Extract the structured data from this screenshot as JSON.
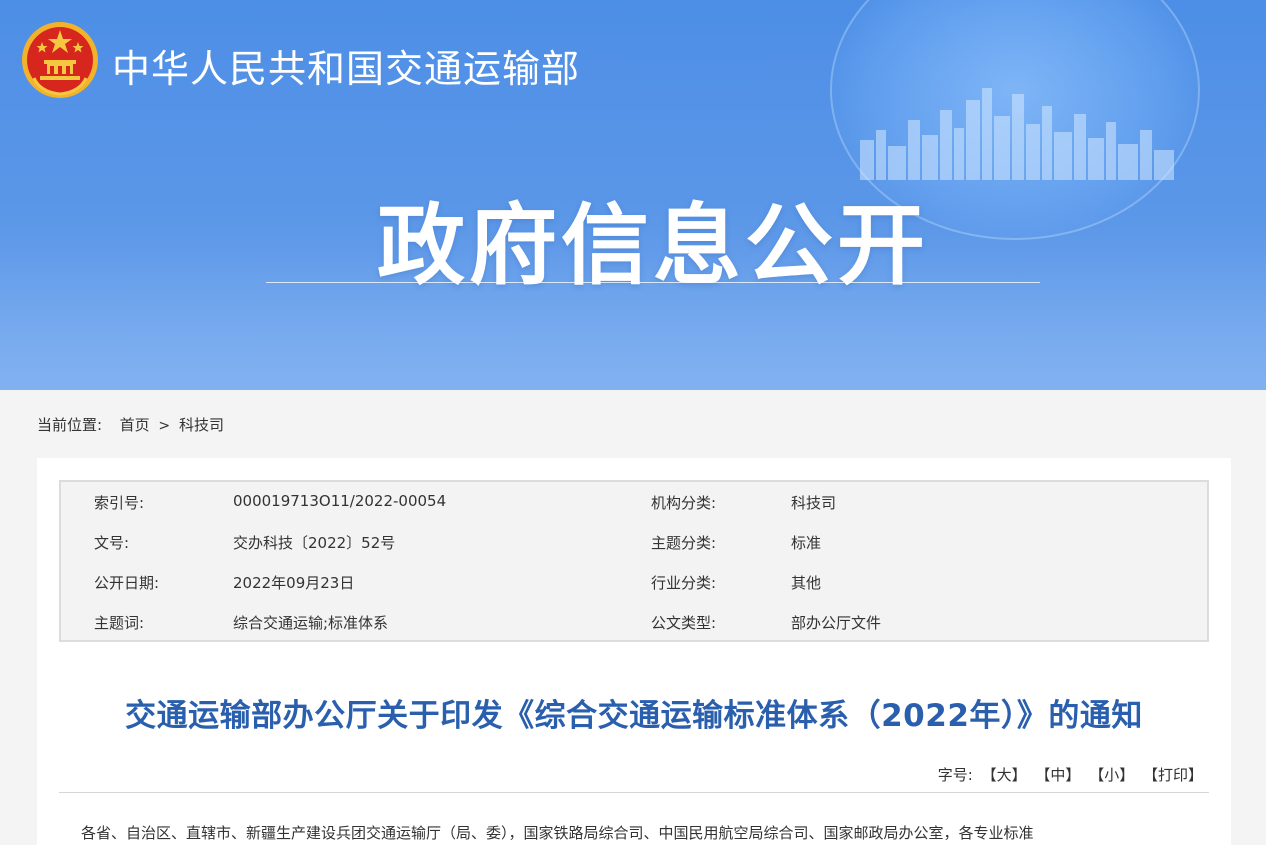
{
  "header": {
    "ministry_name": "中华人民共和国交通运输部",
    "banner_title": "政府信息公开",
    "emblem_icon": "national-emblem-icon"
  },
  "breadcrumb": {
    "label": "当前位置:",
    "items": [
      "首页",
      "科技司"
    ],
    "separator": ">"
  },
  "meta": {
    "rows": [
      {
        "k1": "索引号:",
        "v1": "000019713O11/2022-00054",
        "k2": "机构分类:",
        "v2": "科技司"
      },
      {
        "k1": "文号:",
        "v1": "交办科技〔2022〕52号",
        "k2": "主题分类:",
        "v2": "标准"
      },
      {
        "k1": "公开日期:",
        "v1": "2022年09月23日",
        "k2": "行业分类:",
        "v2": "其他"
      },
      {
        "k1": "主题词:",
        "v1": "综合交通运输;标准体系",
        "k2": "公文类型:",
        "v2": "部办公厅文件"
      }
    ]
  },
  "document": {
    "title": "交通运输部办公厅关于印发《综合交通运输标准体系（2022年）》的通知",
    "body_first_line": "各省、自治区、直辖市、新疆生产建设兵团交通运输厅（局、委），国家铁路局综合司、中国民用航空局综合司、国家邮政局办公室，各专业标准"
  },
  "font_controls": {
    "label": "字号:",
    "large": "【大】",
    "medium": "【中】",
    "small": "【小】",
    "print": "【打印】"
  },
  "colors": {
    "banner": "#4d8ee6",
    "title": "#2a5fae"
  }
}
